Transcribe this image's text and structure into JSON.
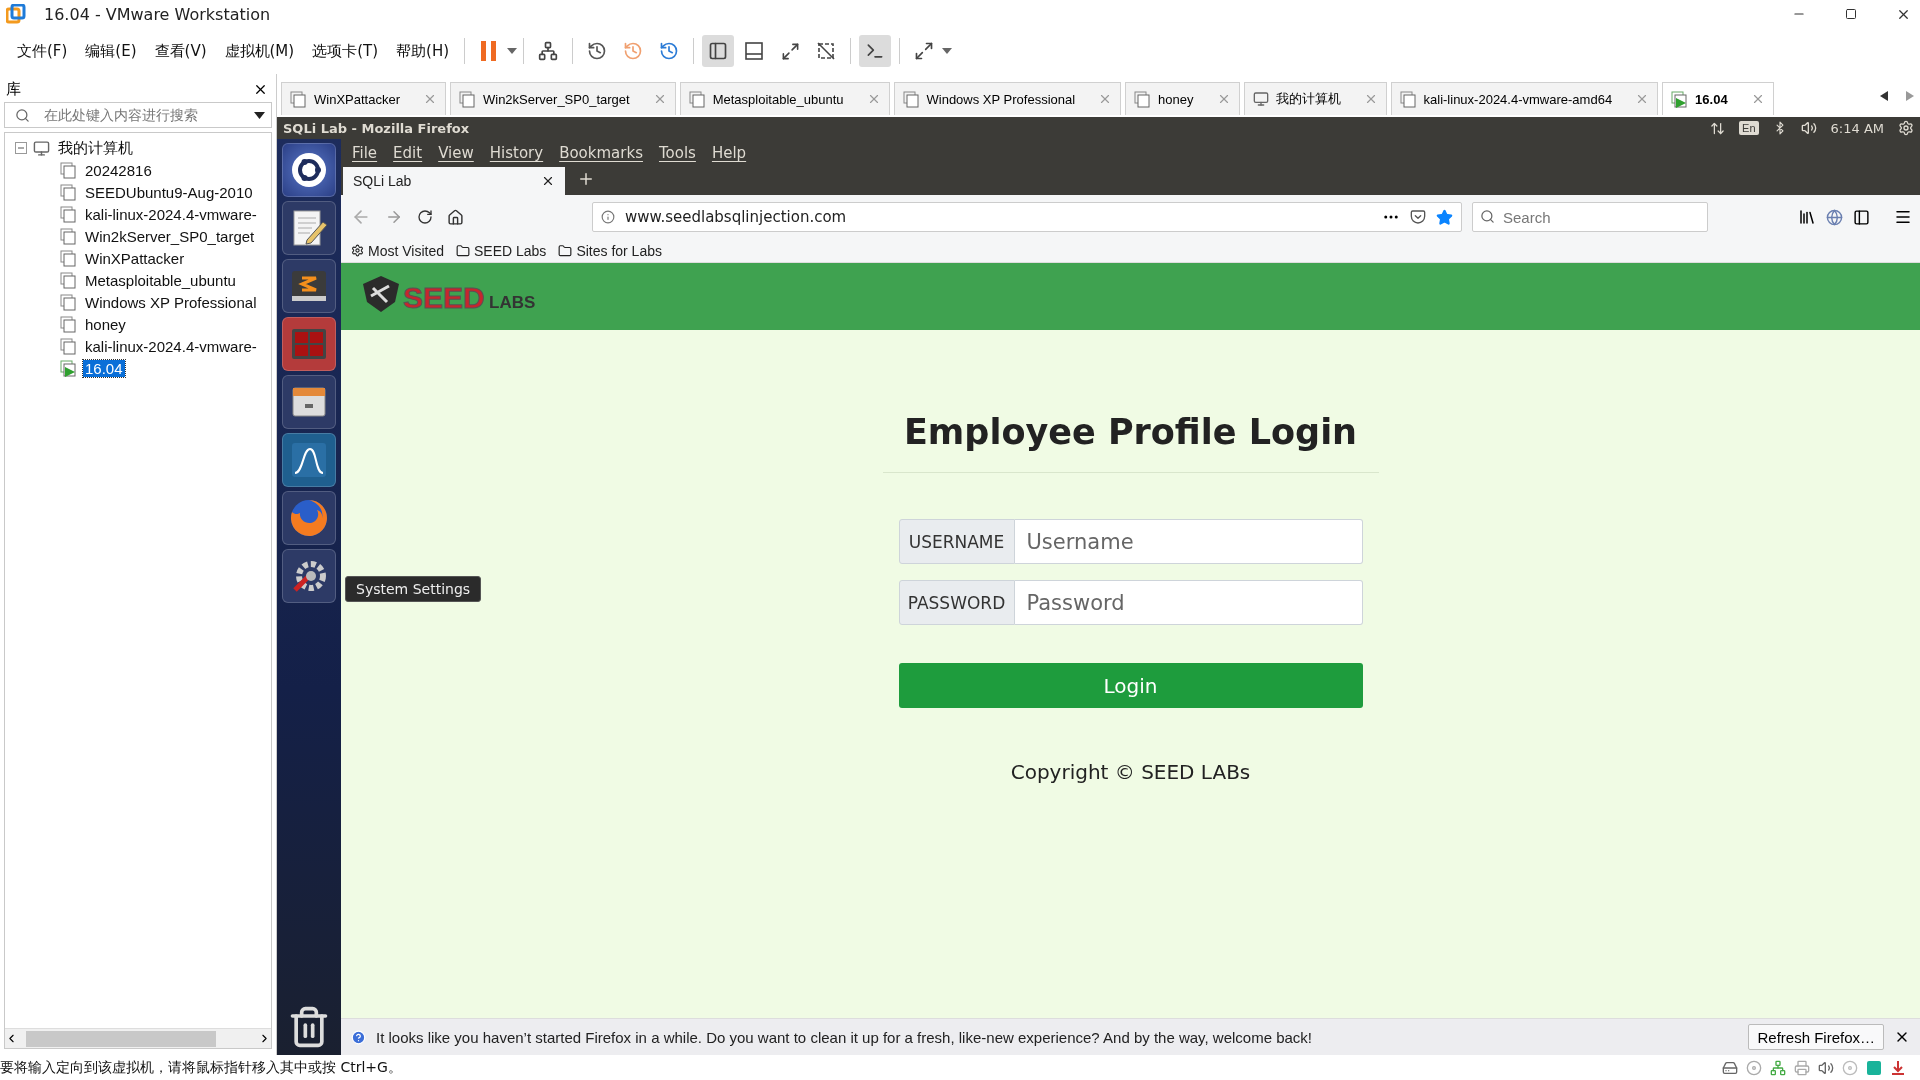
{
  "window": {
    "title": "16.04 - VMware Workstation"
  },
  "menu": [
    {
      "label": "文件(F)"
    },
    {
      "label": "编辑(E)"
    },
    {
      "label": "查看(V)"
    },
    {
      "label": "虚拟机(M)"
    },
    {
      "label": "选项卡(T)"
    },
    {
      "label": "帮助(H)"
    }
  ],
  "library": {
    "title": "库",
    "search": {
      "placeholder": "在此处键入内容进行搜索"
    },
    "tree": [
      {
        "label": "我的计算机",
        "expanded": true,
        "children": [
          {
            "label": "20242816",
            "selected": false,
            "running": false
          },
          {
            "label": "SEEDUbuntu9-Aug-2010",
            "selected": false,
            "running": false
          },
          {
            "label": "kali-linux-2024.4-vmware-",
            "selected": false,
            "running": false
          },
          {
            "label": "Win2kServer_SP0_target",
            "selected": false,
            "running": false
          },
          {
            "label": "WinXPattacker",
            "selected": false,
            "running": false
          },
          {
            "label": "Metasploitable_ubuntu",
            "selected": false,
            "running": false
          },
          {
            "label": "Windows XP Professional",
            "selected": false,
            "running": false
          },
          {
            "label": "honey",
            "selected": false,
            "running": false
          },
          {
            "label": "kali-linux-2024.4-vmware-",
            "selected": false,
            "running": false
          },
          {
            "label": "16.04",
            "selected": true,
            "running": true
          }
        ]
      }
    ]
  },
  "vm_tabs": [
    {
      "label": "WinXPattacker",
      "kind": "vm",
      "selected": false,
      "running": false
    },
    {
      "label": "Win2kServer_SP0_target",
      "kind": "vm",
      "selected": false,
      "running": false
    },
    {
      "label": "Metasploitable_ubuntu",
      "kind": "vm",
      "selected": false,
      "running": false
    },
    {
      "label": "Windows XP Professional",
      "kind": "vm",
      "selected": false,
      "running": false
    },
    {
      "label": "honey",
      "kind": "vm",
      "selected": false,
      "running": false
    },
    {
      "label": "我的计算机",
      "kind": "home",
      "selected": false
    },
    {
      "label": "kali-linux-2024.4-vmware-amd64",
      "kind": "vm",
      "selected": false,
      "running": false
    },
    {
      "label": "16.04",
      "kind": "vm",
      "selected": true,
      "running": true
    }
  ],
  "guest": {
    "top_bar": {
      "title": "SQLi Lab - Mozilla Firefox",
      "keyboard": "En",
      "time": "6:14 AM"
    },
    "launcher_tooltip": "System Settings",
    "firefox": {
      "menu": [
        {
          "label": "File"
        },
        {
          "label": "Edit"
        },
        {
          "label": "View"
        },
        {
          "label": "History"
        },
        {
          "label": "Bookmarks"
        },
        {
          "label": "Tools"
        },
        {
          "label": "Help"
        }
      ],
      "tab": {
        "label": "SQLi Lab"
      },
      "url": "www.seedlabsqlinjection.com",
      "search": {
        "placeholder": "Search"
      },
      "bookmarks": [
        {
          "label": "Most Visited",
          "kind": "gear"
        },
        {
          "label": "SEED Labs",
          "kind": "folder"
        },
        {
          "label": "Sites for Labs",
          "kind": "folder"
        }
      ],
      "logo": {
        "word": "SEED",
        "suffix": "LABS"
      },
      "login": {
        "title": "Employee Profile Login",
        "fields": [
          {
            "label": "USERNAME",
            "placeholder": "Username"
          },
          {
            "label": "PASSWORD",
            "placeholder": "Password"
          }
        ],
        "button": "Login",
        "copyright": "Copyright © SEED LABs"
      },
      "notification": {
        "text": "It looks like you haven’t started Firefox in a while. Do you want to clean it up for a fresh, like-new experience? And by the way, welcome back!",
        "button": "Refresh Firefox…"
      }
    }
  },
  "status_bar": {
    "text": "要将输入定向到该虚拟机，请将鼠标指针移入其中或按 Ctrl+G。"
  }
}
